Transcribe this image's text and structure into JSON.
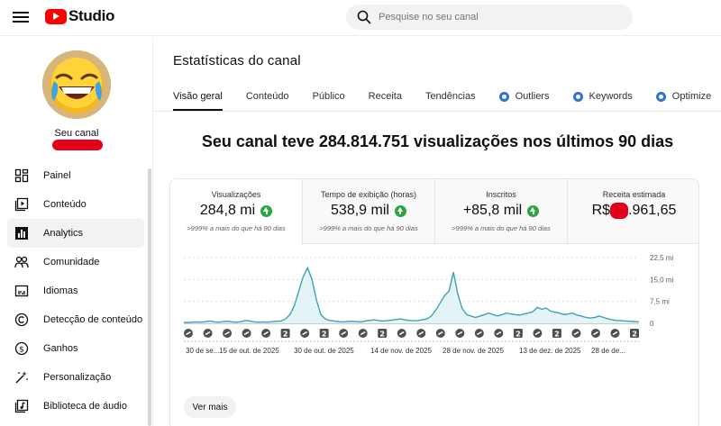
{
  "header": {
    "logo_text": "Studio",
    "search_placeholder": "Pesquise no seu canal"
  },
  "sidebar": {
    "channel_label": "Seu canal",
    "items": [
      {
        "label": "Painel",
        "icon": "dashboard-icon"
      },
      {
        "label": "Conteúdo",
        "icon": "content-icon"
      },
      {
        "label": "Analytics",
        "icon": "analytics-icon",
        "active": true
      },
      {
        "label": "Comunidade",
        "icon": "community-icon"
      },
      {
        "label": "Idiomas",
        "icon": "subtitles-icon"
      },
      {
        "label": "Detecção de conteúdo",
        "icon": "copyright-icon"
      },
      {
        "label": "Ganhos",
        "icon": "earn-icon"
      },
      {
        "label": "Personalização",
        "icon": "customization-icon"
      },
      {
        "label": "Biblioteca de áudio",
        "icon": "audio-library-icon"
      }
    ]
  },
  "main": {
    "title": "Estatísticas do canal",
    "tabs": [
      {
        "label": "Visão geral",
        "active": true
      },
      {
        "label": "Conteúdo"
      },
      {
        "label": "Público"
      },
      {
        "label": "Receita"
      },
      {
        "label": "Tendências"
      },
      {
        "label": "Outliers",
        "extension": true
      },
      {
        "label": "Keywords",
        "extension": true
      },
      {
        "label": "Optimize",
        "extension": true
      }
    ],
    "headline": "Seu canal teve 284.814.751 visualizações nos últimos 90 dias",
    "metrics": [
      {
        "label": "Visualizações",
        "value": "284,8 mi",
        "sub": ">999% a mais do que há 90 dias",
        "up": true
      },
      {
        "label": "Tempo de exibição (horas)",
        "value": "538,9 mil",
        "sub": ">999% a mais do que há 90 dias",
        "up": true
      },
      {
        "label": "Inscritos",
        "value": "+85,8 mil",
        "sub": ">999% a mais do que há 90 dias",
        "up": true
      },
      {
        "label": "Receita estimada",
        "value_prefix": "R$",
        "value_suffix": ".961,65"
      }
    ],
    "more_button": "Ver mais"
  },
  "colors": {
    "accent": "#ff0000",
    "line": "#3fa1b8",
    "area": "#e3f3f6",
    "positive": "#2ba640",
    "extension": "#2f72d7"
  },
  "chart_data": {
    "type": "area",
    "y_tick_labels": [
      "22,5 mi",
      "15,0 mi",
      "7,5 mi",
      "0"
    ],
    "ylim": [
      0,
      22.5
    ],
    "x_tick_labels": [
      "30 de se...",
      "15 de out. de 2025",
      "30 de out. de 2025",
      "14 de nov. de 2025",
      "28 de nov. de 2025",
      "13 de dez. de 2025",
      "28 de de..."
    ],
    "series": [
      {
        "values": [
          0.3,
          0.3,
          0.4,
          0.5,
          0.4,
          0.6,
          0.8,
          0.5,
          0.4,
          0.6,
          0.7,
          0.5,
          0.4,
          0.6,
          1.0,
          0.8,
          0.5,
          0.4,
          0.5,
          0.4,
          0.6,
          0.7,
          0.8,
          1.5,
          3.0,
          6.0,
          11.0,
          16.0,
          19.0,
          15.0,
          8.0,
          3.0,
          1.5,
          1.0,
          0.8,
          0.6,
          0.5,
          0.6,
          0.7,
          0.6,
          0.5,
          0.8,
          1.0,
          1.2,
          1.0,
          0.8,
          0.9,
          1.1,
          1.3,
          1.5,
          1.2,
          1.0,
          0.9,
          1.0,
          1.2,
          1.5,
          2.5,
          4.5,
          7.0,
          9.5,
          11.0,
          17.5,
          10.0,
          5.0,
          3.0,
          2.5,
          2.0,
          2.5,
          3.0,
          3.5,
          3.0,
          2.5,
          3.0,
          3.5,
          3.2,
          3.0,
          2.8,
          3.2,
          3.5,
          4.0,
          5.5,
          4.8,
          5.2,
          4.2,
          3.8,
          3.5,
          3.0,
          3.2,
          3.5,
          2.8,
          2.5,
          2.0,
          1.8,
          2.0,
          2.5,
          2.0,
          1.5,
          1.2,
          1.0,
          0.9,
          0.8,
          0.7,
          0.6,
          0.5
        ]
      }
    ],
    "markers": [
      "dyn",
      "dyn",
      "dyn",
      "dyn",
      "dyn",
      "2",
      "dyn",
      "2",
      "dyn",
      "dyn",
      "2",
      "dyn",
      "dyn",
      "dyn",
      "dyn",
      "dyn",
      "dyn",
      "2",
      "dyn",
      "2",
      "dyn",
      "dyn",
      "dyn",
      "2"
    ],
    "grid": true
  }
}
